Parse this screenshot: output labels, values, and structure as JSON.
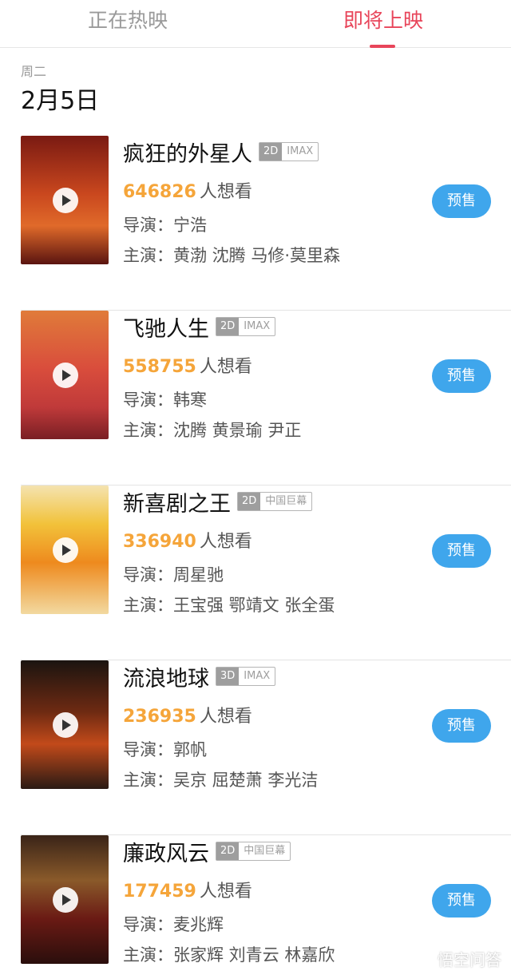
{
  "tabs": {
    "now_showing": "正在热映",
    "coming_soon": "即将上映"
  },
  "date_header": {
    "weekday": "周二",
    "date": "2月5日"
  },
  "want_suffix": "人想看",
  "director_label": "导演：",
  "cast_label": "主演：",
  "presale_label": "预售",
  "movies": [
    {
      "title": "疯狂的外星人",
      "dimension": "2D",
      "format": "IMAX",
      "want_count": "646826",
      "director": "宁浩",
      "cast": "黄渤 沈腾 马修·莫里森"
    },
    {
      "title": "飞驰人生",
      "dimension": "2D",
      "format": "IMAX",
      "want_count": "558755",
      "director": "韩寒",
      "cast": "沈腾 黄景瑜 尹正"
    },
    {
      "title": "新喜剧之王",
      "dimension": "2D",
      "format": "中国巨幕",
      "want_count": "336940",
      "director": "周星驰",
      "cast": "王宝强 鄂靖文 张全蛋"
    },
    {
      "title": "流浪地球",
      "dimension": "3D",
      "format": "IMAX",
      "want_count": "236935",
      "director": "郭帆",
      "cast": "吴京 屈楚萧 李光洁"
    },
    {
      "title": "廉政风云",
      "dimension": "2D",
      "format": "中国巨幕",
      "want_count": "177459",
      "director": "麦兆辉",
      "cast": "张家辉 刘青云 林嘉欣"
    }
  ],
  "colors": {
    "accent": "#e8455a",
    "count": "#f5a53a",
    "presale_button": "#3fa6ec"
  },
  "watermark": "悟空问答"
}
